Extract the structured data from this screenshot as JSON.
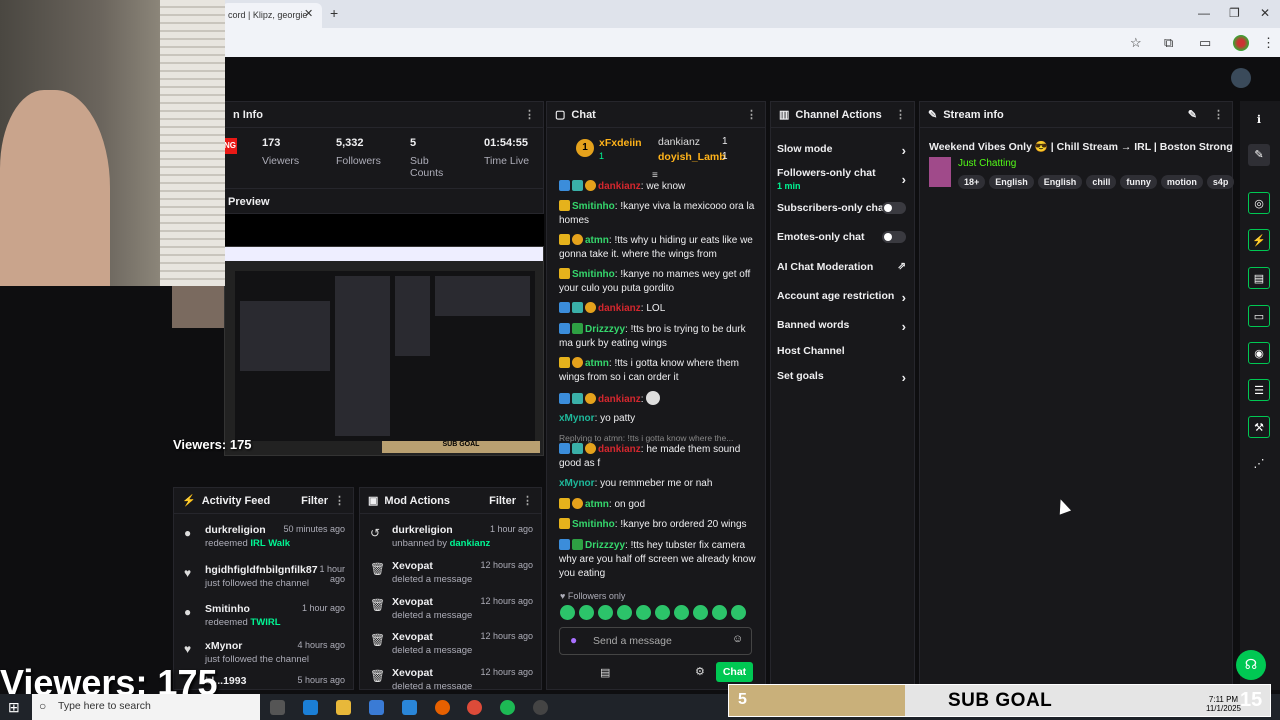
{
  "browser": {
    "tab_title": "cord | Klipz, georgie",
    "tab_close": "✕",
    "new_tab": "+",
    "win_min": "—",
    "win_max": "❐",
    "win_close": "✕"
  },
  "stream_info_left": {
    "title": "n Info",
    "live": "NG",
    "stats": [
      {
        "value": "173",
        "label": "Viewers"
      },
      {
        "value": "5,332",
        "label": "Followers"
      },
      {
        "value": "5",
        "label": "Sub Counts"
      },
      {
        "value": "01:54:55",
        "label": "Time Live"
      }
    ],
    "preview_label": "Preview",
    "mini_subgoal": "SUB GOAL"
  },
  "overlay": {
    "viewers_small": "Viewers: 175",
    "viewers_big": "Viewers: 175"
  },
  "activity_feed": {
    "title": "Activity Feed",
    "filter": "Filter",
    "items": [
      {
        "name": "durkreligion",
        "sub_pre": "redeemed ",
        "sub_hl": "IRL Walk",
        "time": "50 minutes ago"
      },
      {
        "name": "hgidhfigldfnbilgnfilk87",
        "sub_pre": "just followed the channel",
        "sub_hl": "",
        "time": "1 hour ago"
      },
      {
        "name": "Smitinho",
        "sub_pre": "redeemed ",
        "sub_hl": "TWIRL",
        "time": "1 hour ago"
      },
      {
        "name": "xMynor",
        "sub_pre": "just followed the channel",
        "sub_hl": "",
        "time": "4 hours ago"
      },
      {
        "name": "bl...1993",
        "sub_pre": "",
        "sub_hl": "",
        "time": "5 hours ago"
      }
    ]
  },
  "mod_actions": {
    "title": "Mod Actions",
    "filter": "Filter",
    "items": [
      {
        "name": "durkreligion",
        "sub_pre": "unbanned by ",
        "sub_hl": "dankianz",
        "time": "1 hour ago"
      },
      {
        "name": "Xevopat",
        "sub_pre": "deleted a message",
        "sub_hl": "",
        "time": "12 hours ago"
      },
      {
        "name": "Xevopat",
        "sub_pre": "deleted a message",
        "sub_hl": "",
        "time": "12 hours ago"
      },
      {
        "name": "Xevopat",
        "sub_pre": "deleted a message",
        "sub_hl": "",
        "time": "12 hours ago"
      },
      {
        "name": "Xevopat",
        "sub_pre": "deleted a message",
        "sub_hl": "",
        "time": "12 hours ago"
      }
    ]
  },
  "chat": {
    "title": "Chat",
    "leaderboard": [
      {
        "rank": "1",
        "name": "xFxdeiin",
        "count": "1"
      },
      {
        "name": "dankianz",
        "count": "1"
      },
      {
        "name": "doyish_Lamb",
        "count": "1"
      }
    ],
    "messages": [
      {
        "user": "dankianz",
        "text": "we know"
      },
      {
        "user": "Smitinho",
        "text": "!kanye viva la mexicooo ora la homes"
      },
      {
        "user": "atmn",
        "text": "!tts why u hiding ur eats like we gonna take it. where the wings from"
      },
      {
        "user": "Smitinho",
        "text": "!kanye no mames wey get off your culo you puta gordito"
      },
      {
        "user": "dankianz",
        "text": "LOL"
      },
      {
        "user": "Drizzzyy",
        "text": "!tts bro is trying to be durk ma gurk by eating wings"
      },
      {
        "user": "atmn",
        "text": "!tts i gotta know where them wings from so i can order it"
      },
      {
        "user": "dankianz",
        "text": ""
      },
      {
        "user": "xMynor",
        "text": "yo patty"
      },
      {
        "user": "dankianz",
        "text": "he made them sound good as f"
      },
      {
        "user": "xMynor",
        "text": "you remmeber me or nah"
      },
      {
        "user": "atmn",
        "text": "on god"
      },
      {
        "user": "Smitinho",
        "text": "!kanye bro ordered 20 wings"
      },
      {
        "user": "Drizzzyy",
        "text": "!tts hey tubster fix camera why are you half off screen we already know you eating"
      }
    ],
    "reply_line": "Replying to atmn: !tts i gotta know where the...",
    "followers_only": "Followers only",
    "input_placeholder": "Send a message",
    "send_button": "Chat"
  },
  "channel_actions": {
    "title": "Channel Actions",
    "items": [
      {
        "label": "Slow mode"
      },
      {
        "label": "Followers-only chat",
        "sub": "1 min"
      },
      {
        "label": "Subscribers-only chat"
      },
      {
        "label": "Emotes-only chat"
      },
      {
        "label": "AI Chat Moderation"
      },
      {
        "label": "Account age restriction"
      },
      {
        "label": "Banned words"
      },
      {
        "label": "Host Channel"
      },
      {
        "label": "Set goals"
      }
    ]
  },
  "stream_info_right": {
    "title": "Stream info",
    "stream_title": "Weekend Vibes Only 😎 | Chill Stream → IRL | Boston Strong",
    "category": "Just Chatting",
    "tags": [
      "18+",
      "English",
      "English",
      "chill",
      "funny",
      "motion",
      "s4p"
    ]
  },
  "taskbar": {
    "search_placeholder": "Type here to search",
    "time": "7:11 PM",
    "date": "11/1/2025"
  },
  "sub_goal": {
    "current": "5",
    "label": "SUB GOAL",
    "goal": "15"
  },
  "colors": {
    "accent": "#00c853",
    "live": "#e91916",
    "subgoal_fill": "#c9b07a"
  }
}
